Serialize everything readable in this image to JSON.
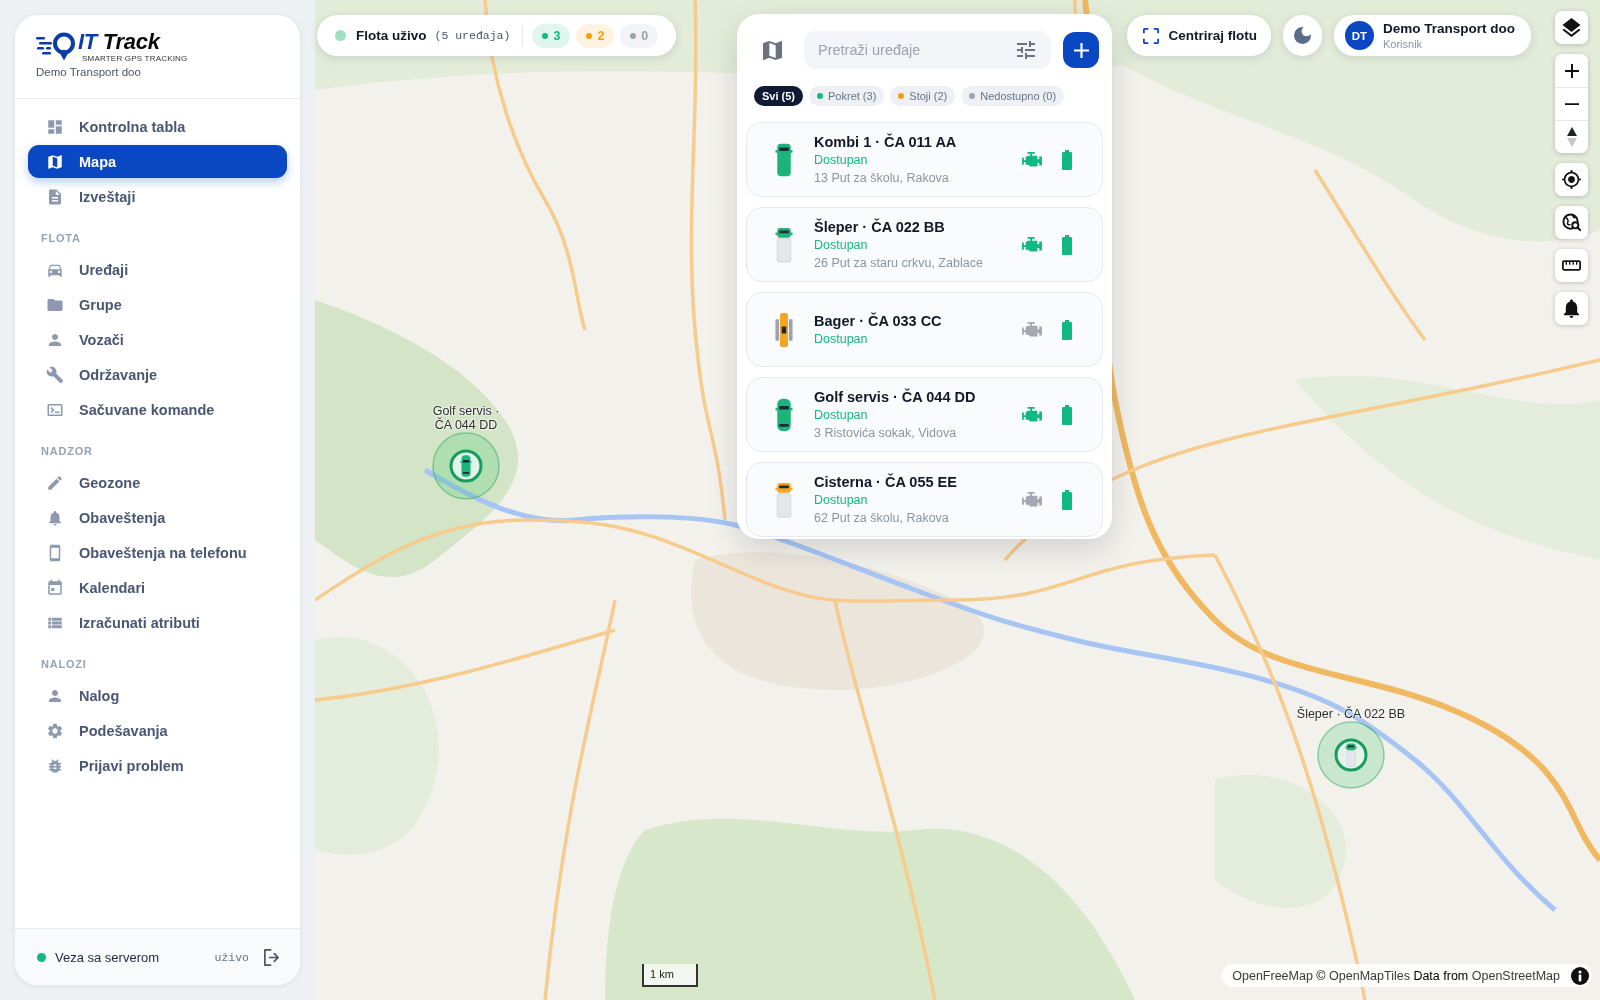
{
  "sidebar": {
    "logo": {
      "brand": [
        "IT",
        "Track"
      ],
      "tagline": "SMARTER GPS TRACKING"
    },
    "company": "Demo Transport doo",
    "sections": [
      {
        "items": [
          {
            "label": "Kontrolna tabla",
            "selected": false
          },
          {
            "label": "Mapa",
            "selected": true
          },
          {
            "label": "Izveštaji",
            "selected": false
          }
        ]
      },
      {
        "title": "FLOTA",
        "items": [
          {
            "label": "Uređaji",
            "selected": false
          },
          {
            "label": "Grupe",
            "selected": false
          },
          {
            "label": "Vozači",
            "selected": false
          },
          {
            "label": "Održavanje",
            "selected": false
          },
          {
            "label": "Sačuvane komande",
            "selected": false
          }
        ]
      },
      {
        "title": "NADZOR",
        "items": [
          {
            "label": "Geozone",
            "selected": false
          },
          {
            "label": "Obaveštenja",
            "selected": false
          },
          {
            "label": "Obaveštenja na telefonu",
            "selected": false
          },
          {
            "label": "Kalendari",
            "selected": false
          },
          {
            "label": "Izračunati atributi",
            "selected": false
          }
        ]
      },
      {
        "title": "NALOZI",
        "items": [
          {
            "label": "Nalog",
            "selected": false
          },
          {
            "label": "Podešavanja",
            "selected": false
          },
          {
            "label": "Prijavi problem",
            "selected": false
          }
        ]
      }
    ],
    "footer": {
      "status": "Veza sa serverom",
      "connected": true,
      "mode": "uživo"
    }
  },
  "fleet_chip": {
    "live": true,
    "title": "Flota uživo",
    "count": "(5 uređaja)",
    "counters": [
      {
        "value": "3",
        "color": "#10b981"
      },
      {
        "value": "2",
        "color": "#f59e0b"
      },
      {
        "value": "0",
        "color": "#9ca3af"
      }
    ]
  },
  "device_panel": {
    "search": {
      "placeholder": "Pretraži uređaje"
    },
    "filters": [
      {
        "label": "Svi (5)",
        "selected": true
      },
      {
        "label": "Pokret (3)",
        "selected": false,
        "color": "#10b981"
      },
      {
        "label": "Stoji (2)",
        "selected": false,
        "color": "#f59e0b"
      },
      {
        "label": "Nedostupno (0)",
        "selected": false,
        "color": "#9ca3af"
      }
    ],
    "devices": [
      {
        "kind": "van",
        "name": "Kombi 1 · ČA 011 AA",
        "status": "Dostupan",
        "address": "13 Put za školu, Rakova",
        "moving": true,
        "ignition": true
      },
      {
        "kind": "truck",
        "name": "Šleper · ČA 022 BB",
        "status": "Dostupan",
        "address": "26 Put za staru crkvu, Zablace",
        "moving": true,
        "ignition": true
      },
      {
        "kind": "tracked",
        "name": "Bager · ČA 033 CC",
        "status": "Dostupan",
        "moving": false,
        "ignition": false
      },
      {
        "kind": "car",
        "name": "Golf servis · ČA 044 DD",
        "status": "Dostupan",
        "address": "3 Ristovića sokak, Vidova",
        "moving": true,
        "ignition": true
      },
      {
        "kind": "truck",
        "name": "Cisterna · ČA 055 EE",
        "status": "Dostupan",
        "address": "62 Put za školu, Rakova",
        "moving": false,
        "ignition": false
      }
    ]
  },
  "top_bar": {
    "center_button": "Centriraj flotu",
    "user": {
      "initials": "DT",
      "name": "Demo Transport doo",
      "role": "Korisnik"
    }
  },
  "map": {
    "markers": [
      {
        "kind": "car",
        "moving": true,
        "label": [
          "Golf servis ·",
          "ČA 044 DD"
        ]
      },
      {
        "kind": "truck",
        "moving": true,
        "label": [
          "Šleper · ČA 022 BB"
        ]
      }
    ],
    "scale": "1 km",
    "attribution": [
      {
        "kind": "link",
        "text": "OpenFreeMap"
      },
      {
        "kind": "text",
        "text": "©"
      },
      {
        "kind": "link",
        "text": "OpenMapTiles"
      },
      {
        "kind": "text",
        "text": "Data from"
      },
      {
        "kind": "link",
        "text": "OpenStreetMap"
      }
    ]
  }
}
